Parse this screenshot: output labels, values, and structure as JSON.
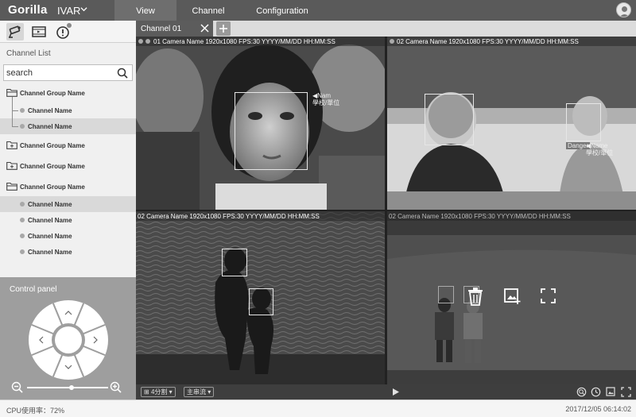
{
  "app": {
    "brand": "Gorilla",
    "product": "IVAR"
  },
  "nav": {
    "tabs": [
      "View",
      "Channel",
      "Configuration"
    ],
    "active": "View"
  },
  "sidebar": {
    "section_title": "Channel List",
    "search": {
      "value": "search"
    },
    "tree": [
      {
        "type": "group",
        "label": "Channel Group Name",
        "state": "expanded"
      },
      {
        "type": "channel",
        "label": "Channel Name"
      },
      {
        "type": "channel",
        "label": "Channel Name",
        "selected": true
      },
      {
        "type": "group",
        "label": "Channel Group Name",
        "state": "collapsed"
      },
      {
        "type": "group",
        "label": "Channel Group Name",
        "state": "collapsed"
      },
      {
        "type": "group",
        "label": "Channel Group Name",
        "state": "expanded"
      },
      {
        "type": "channel",
        "label": "Channel Name",
        "selected": true
      },
      {
        "type": "channel",
        "label": "Channel Name"
      },
      {
        "type": "channel",
        "label": "Channel Name"
      },
      {
        "type": "channel",
        "label": "Channel Name"
      }
    ]
  },
  "control_panel": {
    "title": "Control panel",
    "zoom_level": 0.55
  },
  "tab": {
    "label": "Channel 01"
  },
  "cameras": [
    {
      "caption": "01 Camera Name 1920x1080 FPS:30 YYYY/MM/DD HH:MM:SS",
      "tag_name": "◀Nam",
      "tag_school": "學校/單位"
    },
    {
      "caption": "02 Camera Name 1920x1080 FPS:30 YYYY/MM/DD HH:MM:SS",
      "tag_name": "◀Name",
      "tag_school": "學校/單位",
      "tag_label": "Danger"
    },
    {
      "caption": "02 Camera Name 1920x1080 FPS:30 YYYY/MM/DD HH:MM:SS"
    },
    {
      "caption": "02 Camera Name 1920x1080 FPS:30 YYYY/MM/DD HH:MM:SS"
    }
  ],
  "bottom": {
    "layout_label": "4分割",
    "stream_label": "主串流"
  },
  "status": {
    "cpu": "CPU使用率：72%",
    "datetime": "2017/12/05 06:14:02"
  },
  "colors": {
    "topbar": "#5a5a5a",
    "active_nav": "#6e6e6e",
    "control_bg": "#9e9e9e",
    "tab_bg": "#5c5c5c"
  },
  "icons": [
    "chevron-down-icon",
    "camera-icon",
    "playback-icon",
    "alert-icon",
    "user-avatar-icon",
    "search-icon",
    "folder-open-icon",
    "folder-plus-icon",
    "close-icon",
    "add-tab-icon",
    "trash-icon",
    "snapshot-icon",
    "fullscreen-icon",
    "play-icon",
    "zoom-in-icon",
    "zoom-out-icon",
    "clock-icon",
    "ptz-arrow-icon"
  ]
}
